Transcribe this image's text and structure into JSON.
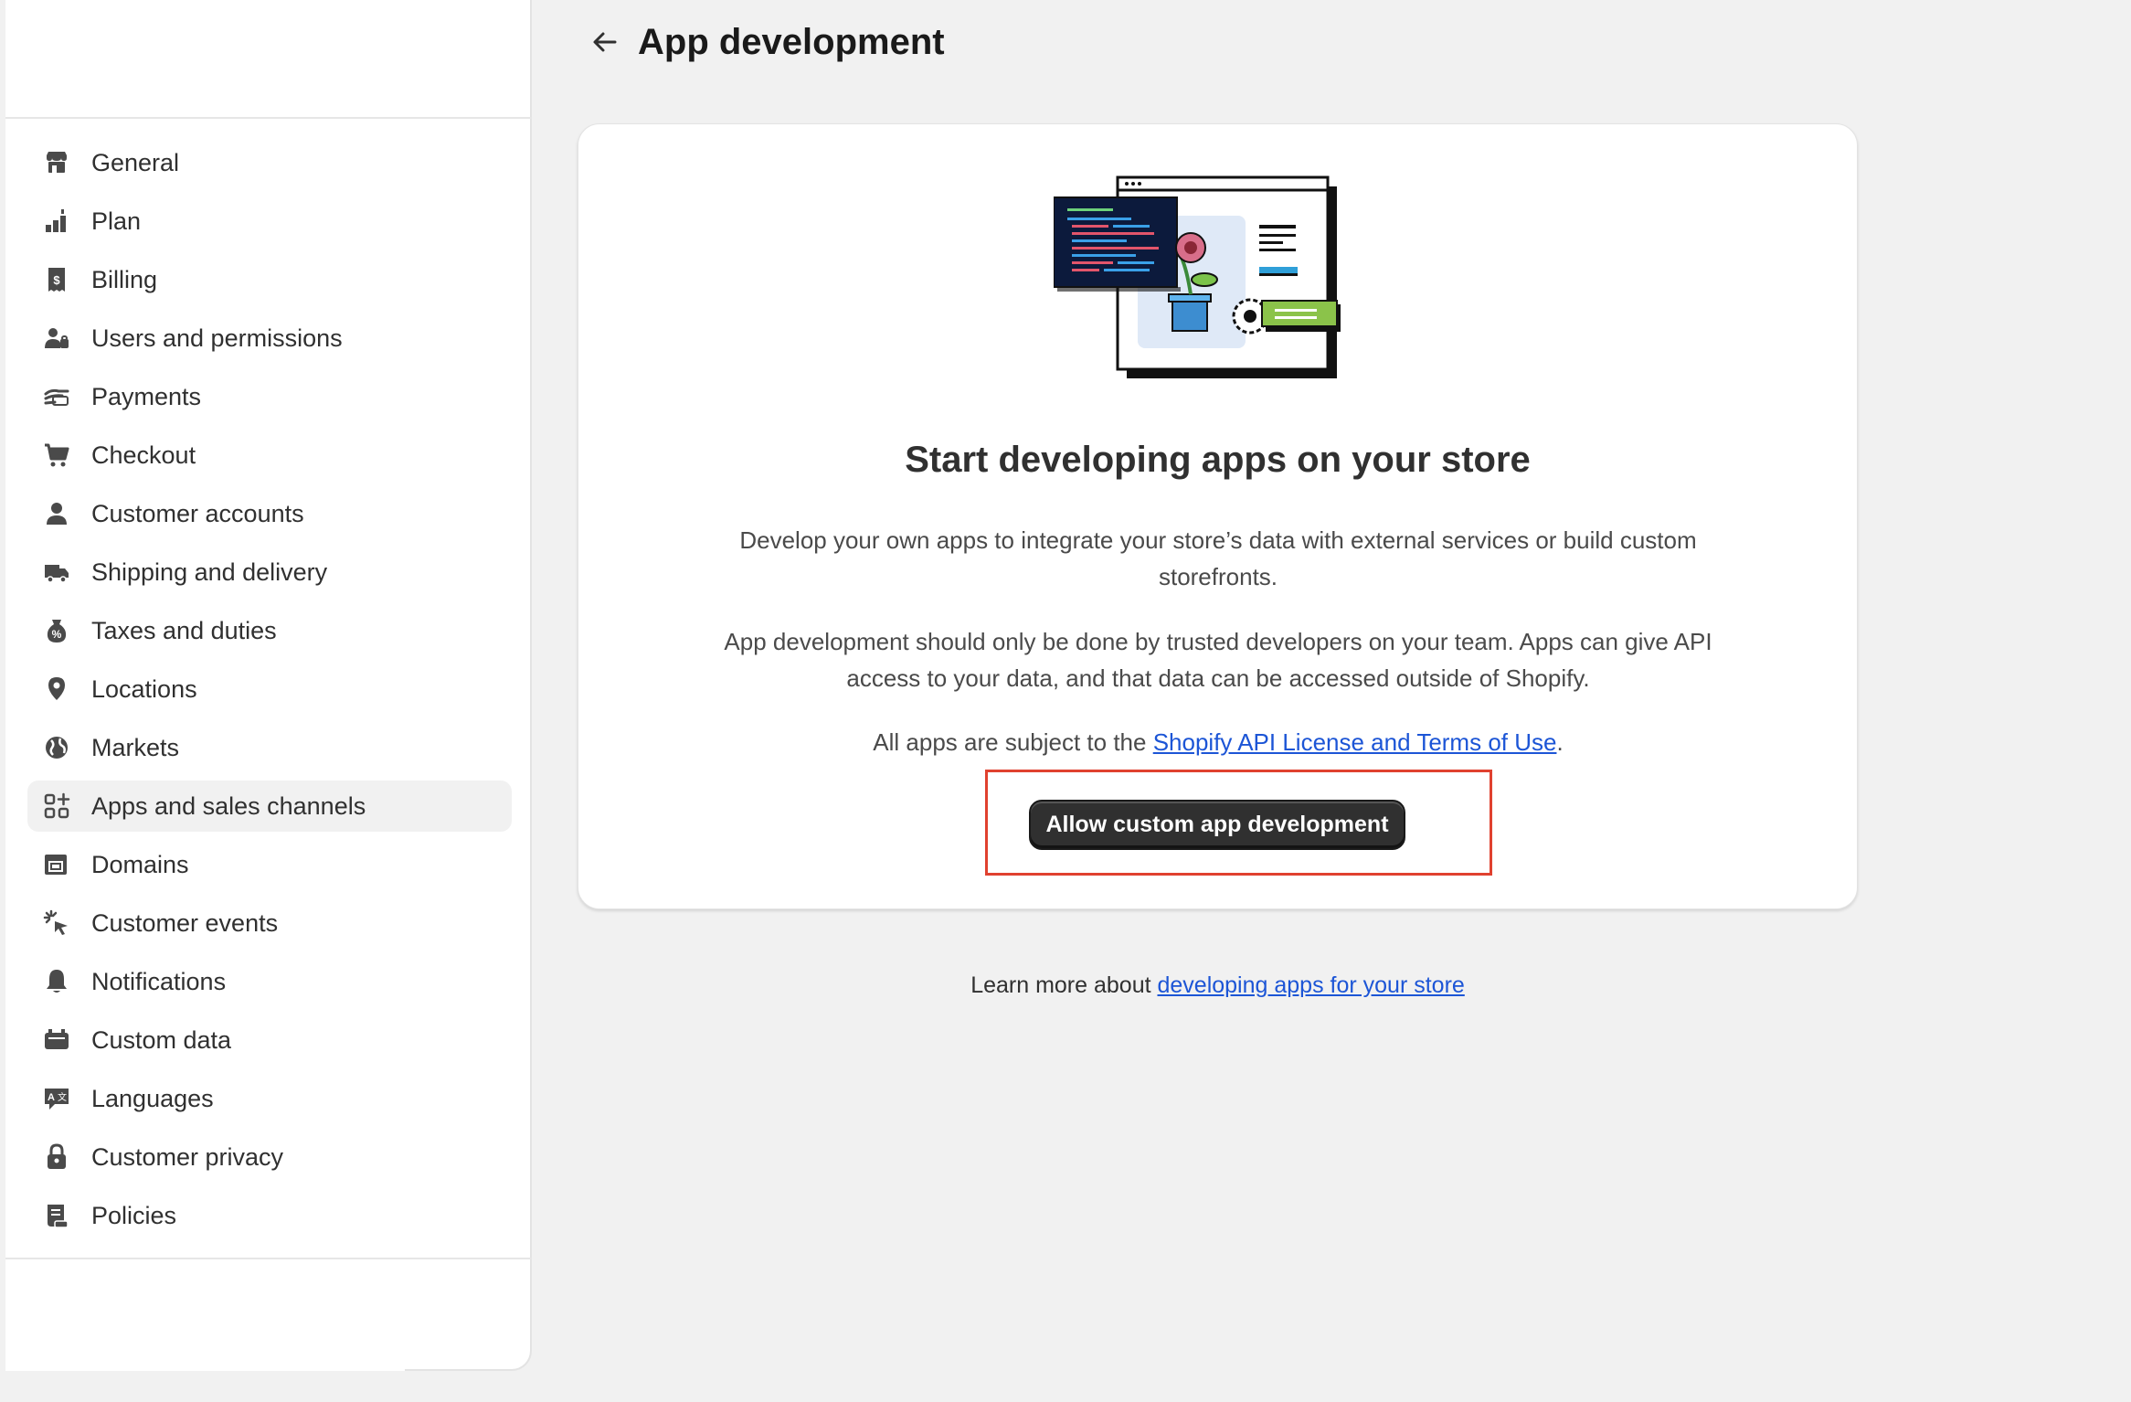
{
  "page": {
    "title": "App development"
  },
  "sidebar": {
    "items": [
      {
        "label": "General",
        "icon": "store-icon",
        "active": false
      },
      {
        "label": "Plan",
        "icon": "plan-icon",
        "active": false
      },
      {
        "label": "Billing",
        "icon": "billing-icon",
        "active": false
      },
      {
        "label": "Users and permissions",
        "icon": "users-icon",
        "active": false
      },
      {
        "label": "Payments",
        "icon": "payments-icon",
        "active": false
      },
      {
        "label": "Checkout",
        "icon": "cart-icon",
        "active": false
      },
      {
        "label": "Customer accounts",
        "icon": "person-icon",
        "active": false
      },
      {
        "label": "Shipping and delivery",
        "icon": "truck-icon",
        "active": false
      },
      {
        "label": "Taxes and duties",
        "icon": "tax-icon",
        "active": false
      },
      {
        "label": "Locations",
        "icon": "location-icon",
        "active": false
      },
      {
        "label": "Markets",
        "icon": "globe-icon",
        "active": false
      },
      {
        "label": "Apps and sales channels",
        "icon": "apps-icon",
        "active": true
      },
      {
        "label": "Domains",
        "icon": "domains-icon",
        "active": false
      },
      {
        "label": "Customer events",
        "icon": "cursor-click-icon",
        "active": false
      },
      {
        "label": "Notifications",
        "icon": "bell-icon",
        "active": false
      },
      {
        "label": "Custom data",
        "icon": "custom-data-icon",
        "active": false
      },
      {
        "label": "Languages",
        "icon": "language-icon",
        "active": false
      },
      {
        "label": "Customer privacy",
        "icon": "lock-icon",
        "active": false
      },
      {
        "label": "Policies",
        "icon": "policies-icon",
        "active": false
      }
    ]
  },
  "card": {
    "heading": "Start developing apps on your store",
    "paragraph1": "Develop your own apps to integrate your store’s data with external services or build custom storefronts.",
    "paragraph2": "App development should only be done by trusted developers on your team. Apps can give API access to your data, and that data can be accessed outside of Shopify.",
    "terms_prefix": "All apps are subject to the ",
    "terms_link": "Shopify API License and Terms of Use",
    "terms_suffix": ".",
    "button_label": "Allow custom app development"
  },
  "footer": {
    "prefix": "Learn more about ",
    "link": "developing apps for your store"
  },
  "colors": {
    "primary_button": "#303030",
    "link": "#1c55d6",
    "highlight": "#e0412f"
  }
}
